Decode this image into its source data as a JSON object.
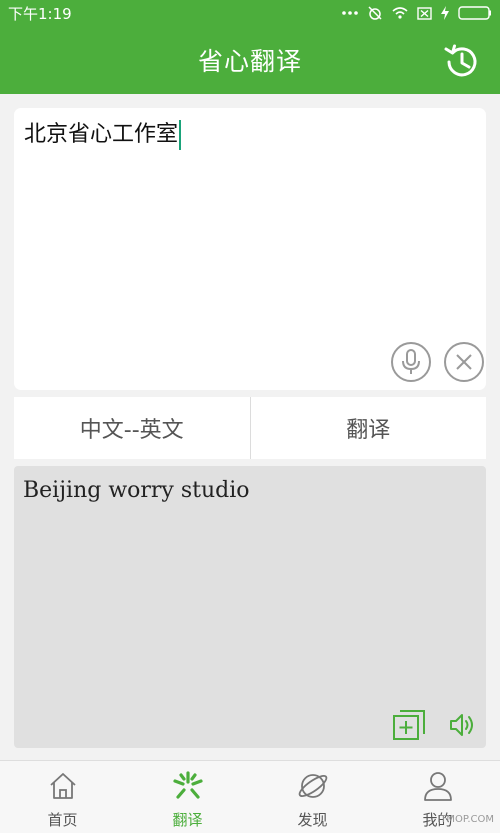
{
  "status_bar": {
    "time": "下午1:19",
    "icons": [
      "more-dots-icon",
      "alarm-off-icon",
      "wifi-icon",
      "sim-off-icon",
      "charging-icon",
      "battery-icon"
    ]
  },
  "header": {
    "title": "省心翻译",
    "history_icon": "history-clock-icon"
  },
  "input": {
    "text": "北京省心工作室"
  },
  "actions": {
    "language_label": "中文--英文",
    "translate_label": "翻译"
  },
  "result": {
    "text": "Beijing worry studio"
  },
  "nav": {
    "items": [
      {
        "label": "首页",
        "icon": "home-icon"
      },
      {
        "label": "翻译",
        "icon": "translate-icon"
      },
      {
        "label": "发现",
        "icon": "planet-icon"
      },
      {
        "label": "我的",
        "icon": "profile-icon"
      }
    ],
    "active_index": 1
  },
  "watermark": "ITMOP.COM",
  "colors": {
    "brand": "#4cae3c",
    "caret": "#1aa37a",
    "result_bg": "#e0e0e0"
  }
}
